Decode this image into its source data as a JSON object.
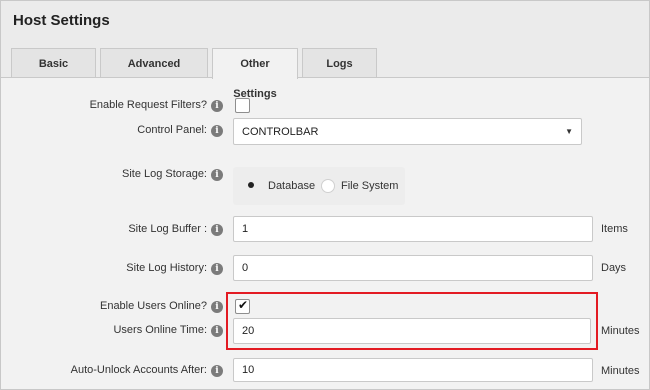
{
  "page": {
    "title": "Host Settings"
  },
  "tabs": [
    {
      "label": "Basic Settings"
    },
    {
      "label": "Advanced Settings"
    },
    {
      "label": "Other Settings"
    },
    {
      "label": "Logs"
    }
  ],
  "fields": {
    "request_filters": {
      "label": "Enable Request Filters?",
      "checked": false
    },
    "control_panel": {
      "label": "Control Panel:",
      "value": "CONTROLBAR"
    },
    "site_log_storage": {
      "label": "Site Log Storage:",
      "options": [
        "Database",
        "File System"
      ],
      "selected": "Database"
    },
    "site_log_buffer": {
      "label": "Site Log Buffer :",
      "value": "1",
      "unit": "Items"
    },
    "site_log_history": {
      "label": "Site Log History:",
      "value": "0",
      "unit": "Days"
    },
    "users_online": {
      "label": "Enable Users Online?",
      "checked": true
    },
    "users_online_time": {
      "label": "Users Online Time:",
      "value": "20",
      "unit": "Minutes"
    },
    "auto_unlock": {
      "label": "Auto-Unlock Accounts After:",
      "value": "10",
      "unit": "Minutes"
    }
  },
  "icons": {
    "info": "info-icon",
    "checkmark": "checkmark-icon",
    "caret": "caret-down-icon"
  },
  "colors": {
    "highlight": "#e31b23"
  }
}
